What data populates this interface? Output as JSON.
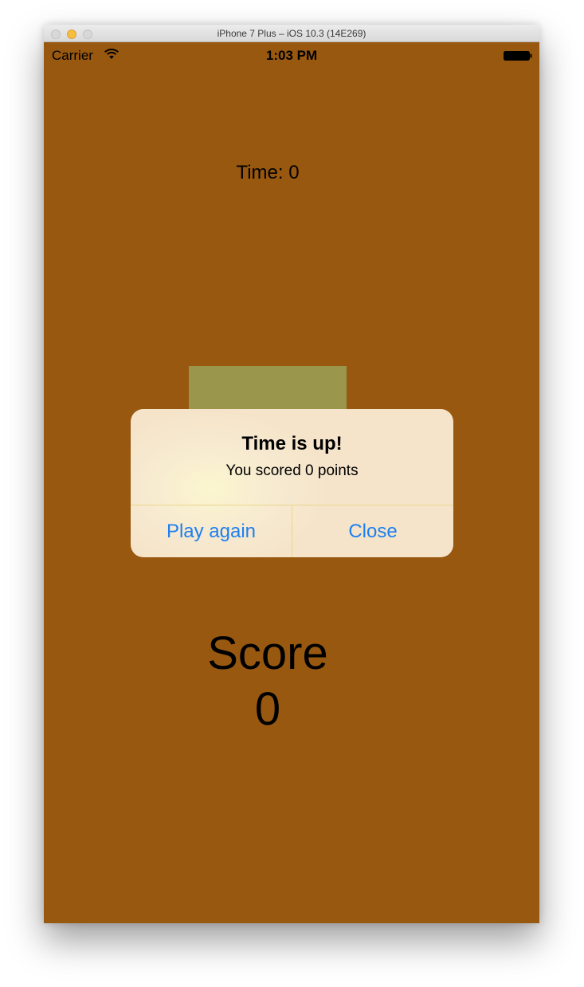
{
  "window": {
    "title": "iPhone 7 Plus – iOS 10.3 (14E269)"
  },
  "status_bar": {
    "carrier": "Carrier",
    "time": "1:03 PM",
    "icons": [
      "wifi-icon",
      "battery-icon"
    ]
  },
  "game": {
    "time_label": "Time: 0",
    "score_title": "Score",
    "score_value": "0",
    "background_color": "#985810",
    "target_color": "#9a964c"
  },
  "alert": {
    "title": "Time is up!",
    "message": "You scored 0 points",
    "buttons": [
      "Play again",
      "Close"
    ],
    "button_color": "#1d7ff0"
  }
}
